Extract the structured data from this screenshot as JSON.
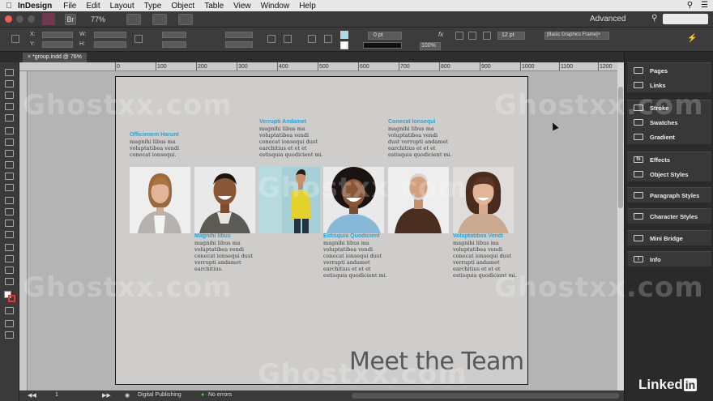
{
  "menubar": {
    "app": "InDesign",
    "items": [
      "File",
      "Edit",
      "Layout",
      "Type",
      "Object",
      "Table",
      "View",
      "Window",
      "Help"
    ]
  },
  "appbar": {
    "zoom": "77%",
    "workspace": "Advanced",
    "br_label": "Br"
  },
  "control": {
    "x_label": "X:",
    "y_label": "Y:",
    "w_label": "W:",
    "h_label": "H:",
    "stroke_weight": "0 pt",
    "opacity": "100%",
    "spacing": "12 pt",
    "frame_style": "[Basic Graphics Frame]+"
  },
  "document": {
    "tab_title": "*group.indd @ 76%"
  },
  "ruler": {
    "ticks": [
      "0",
      "100",
      "200",
      "300",
      "400",
      "500",
      "600",
      "700",
      "800",
      "900",
      "1000",
      "1100",
      "1200"
    ]
  },
  "team": [
    {
      "name": "Officienem Harunt",
      "body": "magnihi libus ma\nvoluptatibea vendi\nconecat ionsequi."
    },
    {
      "name": "Magnihi libus",
      "body": "magnihi libus ma\nvoluptatibea vendi\nconecat ionsequi dust\nverrupti andamet\nearchitius."
    },
    {
      "name": "Verrupti Andamet",
      "body": "magnihi libus ma\nvoluptatibea vendi\nconecat ionsequi dust\nearchitius et et et\nestisquia quodicient mi."
    },
    {
      "name": "Estisquia Quodicient",
      "body": "magnihi libus ma\nvoluptatibea vendi\nconecat ionsequi dust\nverrupti andamet\nearchitius et et et\nestisquia quodicient mi."
    },
    {
      "name": "Conecat Ionsequi",
      "body": "magnihi libus ma\nvoluptatibea vendi\ndust verrupti andamet\nearchitius et et et\nestisquia quodicient mi."
    },
    {
      "name": "Voluptatibea Vendi",
      "body": "magnihi libus ma\nvoluptatibea vendi\nconecat ionsequi dust\nverrupti andamet\nearchitius et et et\nestisquia quodicient mi."
    }
  ],
  "page_title": "Meet the Team",
  "statusbar": {
    "page": "1",
    "profile": "Digital Publishing",
    "errors": "No errors"
  },
  "panels": {
    "group1": [
      "Pages",
      "Links"
    ],
    "group2": [
      "Stroke",
      "Swatches",
      "Gradient"
    ],
    "group3": [
      "Effects",
      "Object Styles"
    ],
    "group4": [
      "Paragraph Styles"
    ],
    "group5": [
      "Character Styles"
    ],
    "group6": [
      "Mini Bridge"
    ],
    "group7": [
      "Info"
    ]
  },
  "watermark": "Ghostxx.com",
  "branding": {
    "linkedin_text": "Linked",
    "linkedin_box": "in"
  },
  "colors": {
    "accent": "#29a3d1",
    "page": "#cfcdcb",
    "pasteboard": "#b4b4b4",
    "ui_dark": "#3a3a3a"
  }
}
